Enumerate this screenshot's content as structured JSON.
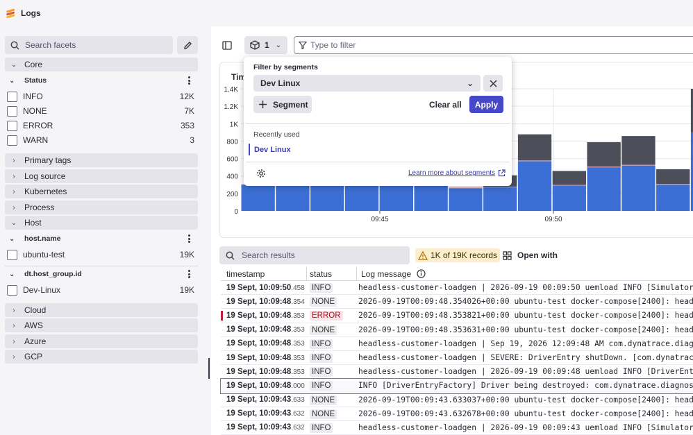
{
  "app": {
    "title": "Logs"
  },
  "sidebar": {
    "search_placeholder": "Search facets",
    "core_label": "Core",
    "status_label": "Status",
    "status_items": [
      {
        "label": "INFO",
        "count": "12K"
      },
      {
        "label": "NONE",
        "count": "7K"
      },
      {
        "label": "ERROR",
        "count": "353"
      },
      {
        "label": "WARN",
        "count": "3"
      }
    ],
    "sections_a": [
      "Primary tags",
      "Log source",
      "Kubernetes",
      "Process"
    ],
    "host_label": "Host",
    "hostname_label": "host.name",
    "hostname_item": {
      "label": "ubuntu-test",
      "count": "19K"
    },
    "hostgroup_label": "dt.host_group.id",
    "hostgroup_item": {
      "label": "Dev-Linux",
      "count": "19K"
    },
    "sections_b": [
      "Cloud",
      "AWS",
      "Azure",
      "GCP"
    ]
  },
  "toolbar": {
    "segment_count": "1",
    "filter_placeholder": "Type to filter"
  },
  "popover": {
    "label": "Filter by segments",
    "selected_segment": "Dev Linux",
    "add_segment": "Segment",
    "clear_all": "Clear all",
    "apply": "Apply",
    "recent_label": "Recently used",
    "recent_item": "Dev Linux",
    "learn_more": "Learn more about segments"
  },
  "chart_tab_partial": "Tim",
  "chart_data": {
    "type": "bar",
    "stacked": true,
    "y_ticks": [
      "0",
      "200",
      "400",
      "600",
      "800",
      "1K",
      "1.2K",
      "1.4K"
    ],
    "ylim": [
      0,
      1400
    ],
    "x_ticks": [
      "09:45",
      "09:50"
    ],
    "series": [
      {
        "name": "",
        "color": "#3c6fd6",
        "values": [
          300,
          1400,
          350,
          300,
          390,
          520,
          260,
          270,
          570,
          290,
          500,
          520,
          300,
          900
        ]
      },
      {
        "name": "",
        "color": "#e4a0a8",
        "values": [
          8,
          0,
          8,
          8,
          5,
          0,
          8,
          8,
          8,
          8,
          8,
          8,
          8,
          0
        ]
      },
      {
        "name": "",
        "color": "#4c4e5a",
        "values": [
          0,
          0,
          0,
          130,
          0,
          0,
          0,
          130,
          300,
          160,
          280,
          330,
          170,
          500
        ]
      }
    ]
  },
  "results": {
    "search_placeholder": "Search results",
    "records_badge": "1K of 19K records",
    "open_with": "Open with",
    "columns": [
      "timestamp",
      "status",
      "Log message"
    ],
    "rows": [
      {
        "ts": "19 Sept, 10:09:50",
        "ms": ".458",
        "status": "INFO",
        "msg": "headless-customer-loadgen | 2026-09-19 00:09:50 uemload INFO [Simulator"
      },
      {
        "ts": "19 Sept, 10:09:48",
        "ms": ".354",
        "status": "NONE",
        "msg": "2026-09-19T00:09:48.354026+00:00 ubuntu-test docker-compose[2400]: head"
      },
      {
        "ts": "19 Sept, 10:09:48",
        "ms": ".353",
        "status": "ERROR",
        "msg": "2026-09-19T00:09:48.353821+00:00 ubuntu-test docker-compose[2400]: head"
      },
      {
        "ts": "19 Sept, 10:09:48",
        "ms": ".353",
        "status": "NONE",
        "msg": "2026-09-19T00:09:48.353631+00:00 ubuntu-test docker-compose[2400]: head"
      },
      {
        "ts": "19 Sept, 10:09:48",
        "ms": ".353",
        "status": "INFO",
        "msg": "headless-customer-loadgen | Sep 19, 2026 12:09:48 AM com.dynatrace.diag"
      },
      {
        "ts": "19 Sept, 10:09:48",
        "ms": ".353",
        "status": "INFO",
        "msg": "headless-customer-loadgen | SEVERE: DriverEntry shutDown. [com.dynatrac"
      },
      {
        "ts": "19 Sept, 10:09:48",
        "ms": ".353",
        "status": "INFO",
        "msg": "headless-customer-loadgen | 2026-09-19 00:09:48 uemload INFO [DriverEnt"
      },
      {
        "ts": "19 Sept, 10:09:48",
        "ms": ".000",
        "status": "INFO",
        "msg": "INFO [DriverEntryFactory] Driver being destroyed: com.dynatrace.diagnos"
      },
      {
        "ts": "19 Sept, 10:09:43",
        "ms": ".633",
        "status": "NONE",
        "msg": "2026-09-19T00:09:43.633037+00:00 ubuntu-test docker-compose[2400]: head"
      },
      {
        "ts": "19 Sept, 10:09:43",
        "ms": ".632",
        "status": "NONE",
        "msg": "2026-09-19T00:09:43.632678+00:00 ubuntu-test docker-compose[2400]: head"
      },
      {
        "ts": "19 Sept, 10:09:43",
        "ms": ".632",
        "status": "INFO",
        "msg": "headless-customer-loadgen | 2026-09-19 00:09:43 uemload INFO [Simulator"
      }
    ]
  }
}
